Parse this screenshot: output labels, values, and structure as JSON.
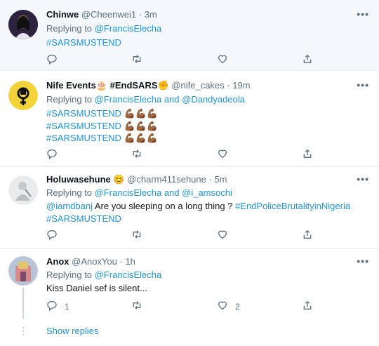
{
  "tweets": [
    {
      "name": "Chinwe",
      "handle": "@Cheenwei1",
      "time": "· 3m",
      "replying_prefix": "Replying to ",
      "replying_to": "@FrancisElecha",
      "lines": [
        "#SARSMUSTEND"
      ],
      "counts": {
        "reply": "",
        "retweet": "",
        "like": ""
      }
    },
    {
      "name": "Nife Events🎂 #EndSARS✊",
      "handle": "@nife_cakes",
      "time": "· 19m",
      "replying_prefix": "Replying to ",
      "replying_to": "@FrancisElecha and @Dandyadeola",
      "lines": [
        "#SARSMUSTEND 💪🏾💪🏾💪🏾",
        "#SARSMUSTEND 💪🏾💪🏾💪🏾",
        "#SARSMUSTEND 💪🏾💪🏾💪🏾"
      ],
      "counts": {
        "reply": "",
        "retweet": "",
        "like": ""
      }
    },
    {
      "name": "Holuwasehune 😊",
      "handle": "@charm411sehune",
      "time": "· 5m",
      "replying_prefix": "Replying to ",
      "replying_to": "@FrancisElecha and @i_amsochi",
      "line1_mention": "@iamdbanj",
      "line1_text": " Are you sleeping on a long thing ? ",
      "line1_tag": "#EndPoliceBrutalityinNigeria",
      "line2": "#SARSMUSTEND",
      "counts": {
        "reply": "",
        "retweet": "",
        "like": ""
      }
    },
    {
      "name": "Anox",
      "handle": "@AnoxYou",
      "time": "· 1h",
      "replying_prefix": "Replying to ",
      "replying_to": "@FrancisElecha",
      "lines": [
        "Kiss Daniel sef is silent..."
      ],
      "counts": {
        "reply": "1",
        "retweet": "",
        "like": "2"
      }
    }
  ],
  "show_replies": "Show replies",
  "more_label": "•••",
  "icons": {
    "reply": "reply-icon",
    "retweet": "retweet-icon",
    "like": "heart-icon",
    "share": "share-icon",
    "more": "more-icon"
  },
  "colors": {
    "link": "#1b95e0",
    "muted": "#5b7083",
    "highlight_bg": "#f5f8fa"
  }
}
